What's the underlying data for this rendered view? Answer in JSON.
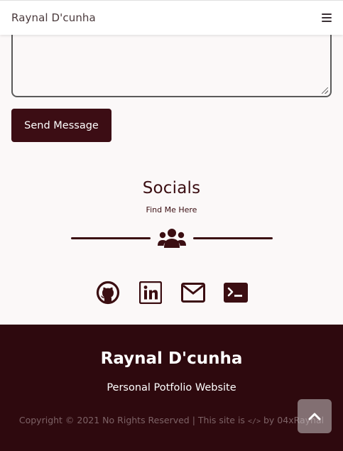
{
  "navbar": {
    "brand": "Raynal D'cunha",
    "menu_icon": "hamburger-icon"
  },
  "contact_form": {
    "message_value": "",
    "send_label": "Send Message"
  },
  "socials": {
    "title": "Socials",
    "subtitle": "Find Me Here",
    "divider_icon": "users-icon",
    "links": [
      {
        "icon": "github-icon"
      },
      {
        "icon": "linkedin-icon"
      },
      {
        "icon": "mail-icon"
      },
      {
        "icon": "terminal-icon"
      }
    ]
  },
  "footer": {
    "name": "Raynal D'cunha",
    "tagline": "Personal Potfolio Website",
    "copyright_prefix": "Copyright © 2021 No Rights Reserved | This site is",
    "copyright_glyph": "</>",
    "copyright_suffix": "by 04xRaynal",
    "scroll_top_icon": "chevron-up-icon"
  },
  "colors": {
    "primary": "#3c0d14",
    "footer_bg": "#2e090e",
    "page_bg": "#fbf8f8"
  }
}
